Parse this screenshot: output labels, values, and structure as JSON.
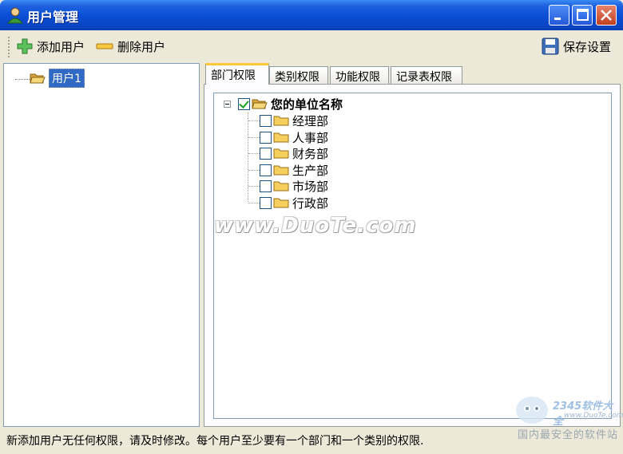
{
  "window": {
    "title": "用户管理"
  },
  "toolbar": {
    "add_label": "添加用户",
    "delete_label": "删除用户",
    "save_label": "保存设置"
  },
  "users": [
    {
      "label": "用户1"
    }
  ],
  "tabs": [
    {
      "label": "部门权限",
      "active": true
    },
    {
      "label": "类别权限",
      "active": false
    },
    {
      "label": "功能权限",
      "active": false
    },
    {
      "label": "记录表权限",
      "active": false
    }
  ],
  "dept_tree": {
    "root": {
      "label": "您的单位名称",
      "checked": true
    },
    "children": [
      {
        "label": "经理部",
        "checked": false
      },
      {
        "label": "人事部",
        "checked": false
      },
      {
        "label": "财务部",
        "checked": false
      },
      {
        "label": "生产部",
        "checked": false
      },
      {
        "label": "市场部",
        "checked": false
      },
      {
        "label": "行政部",
        "checked": false
      }
    ]
  },
  "watermark": "www.DuoTe.com",
  "status": {
    "text": "新添加用户无任何权限，请及时修改。每个用户至少要有一个部门和一个类别的权限."
  },
  "logo": {
    "main": "2345软件大全",
    "url": "www.DuoTe.com",
    "tagline": "国内最安全的软件站"
  },
  "colors": {
    "titlebar": "#0a4fd6",
    "selection": "#316ac5",
    "tab_accent": "#ffc83c",
    "close": "#c0401f"
  }
}
